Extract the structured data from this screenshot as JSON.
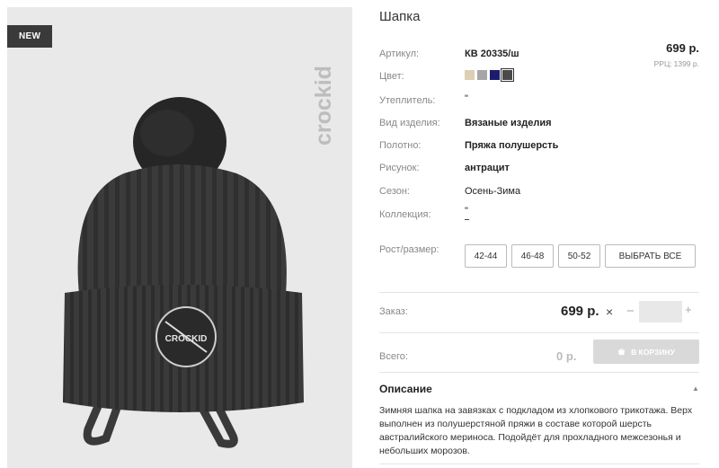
{
  "badge": "NEW",
  "brand": "crockid",
  "hat_patch": "CROCKID",
  "product": {
    "title": "Шапка",
    "price": "699 р.",
    "rrp_label": "РРЦ:",
    "rrp_value": "1399 р."
  },
  "attributes": [
    {
      "label": "Артикул:",
      "value": "КВ 20335/ш"
    },
    {
      "label": "Цвет:",
      "value": ""
    },
    {
      "label": "Утеплитель:",
      "value": "\""
    },
    {
      "label": "Вид изделия:",
      "value": "Вязаные изделия"
    },
    {
      "label": "Полотно:",
      "value": "Пряжа полушерсть"
    },
    {
      "label": "Рисунок:",
      "value": "антрацит"
    },
    {
      "label": "Сезон:",
      "value": "Осень-Зима"
    },
    {
      "label": "Коллекция:",
      "value": "\""
    }
  ],
  "colors": [
    "#ddcfb2",
    "#a6a6a6",
    "#1c1c6e",
    "#4a4a4a"
  ],
  "sizes": {
    "label": "Рост/размер:",
    "options": [
      "42-44",
      "46-48",
      "50-52"
    ],
    "select_all": "ВЫБРАТЬ ВСЕ"
  },
  "order": {
    "label": "Заказ:",
    "price": "699 р.",
    "times": "×",
    "minus": "−",
    "plus": "+",
    "quantity": ""
  },
  "total": {
    "label": "Всего:",
    "value": "0 р.",
    "cart_button": "В КОРЗИНУ"
  },
  "description": {
    "header": "Описание",
    "text": "Зимняя шапка на завязках с подкладом из хлопкового трикотажа. Верх выполнен из полушерстяной пряжи в составе которой шерсть австралийского мериноса. Подойдёт для прохладного межсезонья и небольших морозов."
  }
}
